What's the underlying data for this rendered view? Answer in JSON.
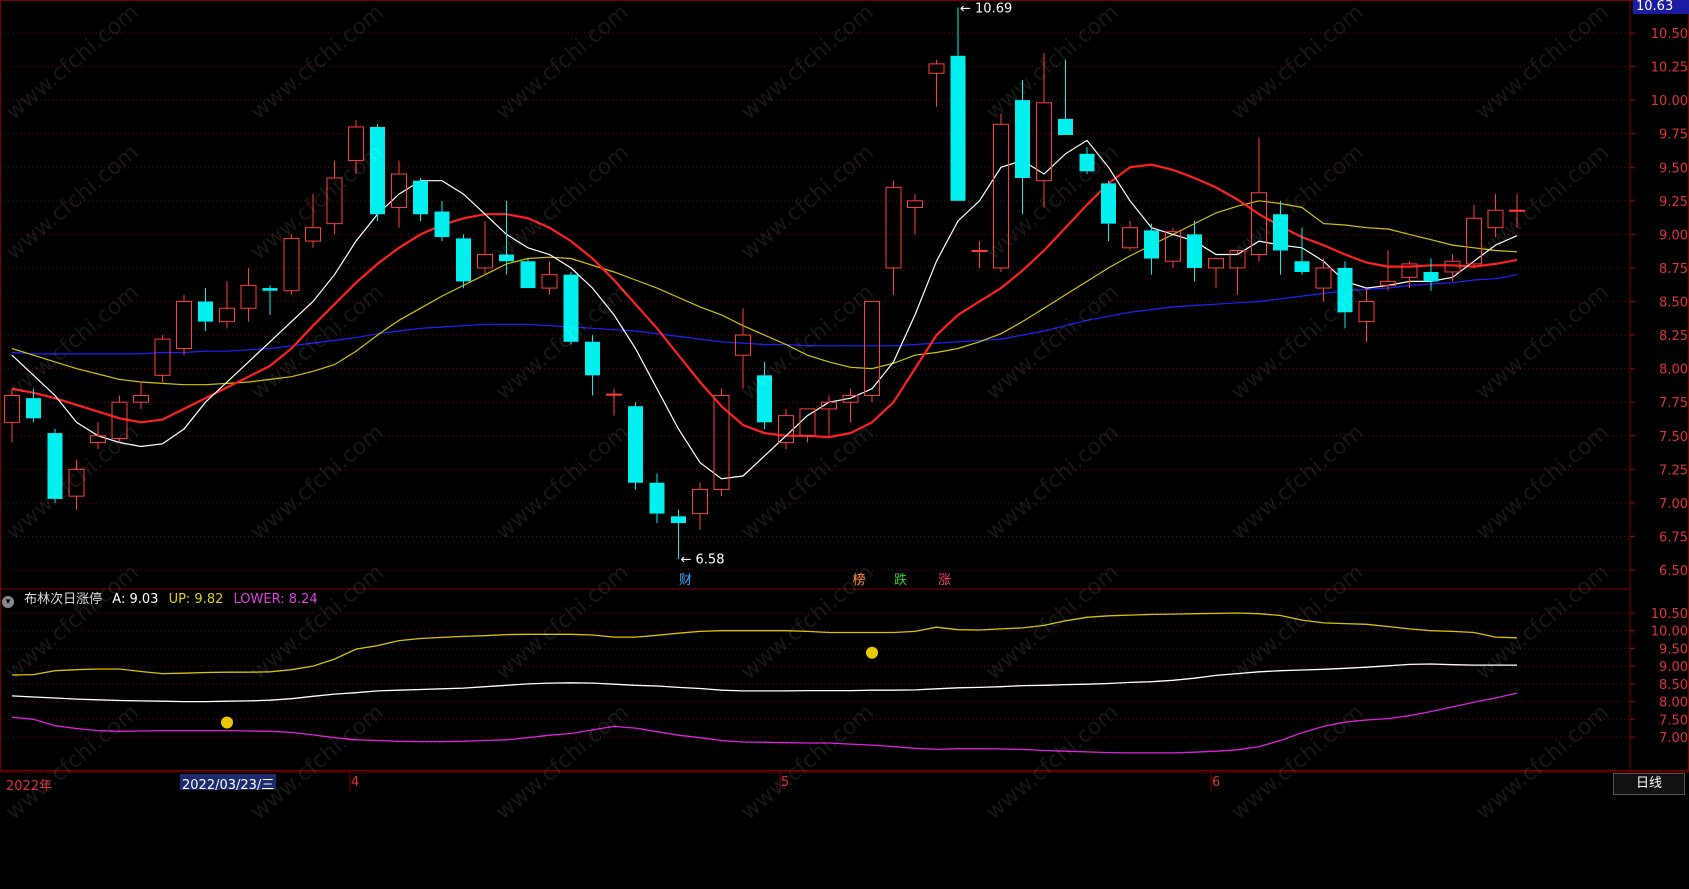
{
  "price_tag": "10.63",
  "period_label": "日线",
  "indicator": {
    "name": "布林次日涨停",
    "a_label": "A: 9.03",
    "up_label": "UP: 9.82",
    "lower_label": "LOWER: 8.24"
  },
  "x_axis": {
    "year_label": "2022年",
    "cursor_date": "2022/03/23/三",
    "months": [
      "4",
      "5",
      "6"
    ]
  },
  "markers": {
    "high_label": "10.69",
    "low_label": "6.58",
    "events": [
      "财",
      "榜",
      "跌",
      "涨"
    ]
  },
  "watermark": "www.cfchi.com",
  "colors": {
    "up": "#ff3b3b",
    "down": "#00f0f0",
    "ma5": "#ffffff",
    "ma10": "#ff2020",
    "ma20": "#d6c400",
    "ma60": "#2020ff",
    "grid": "#7a0000",
    "boll_up": "#d6c400",
    "boll_mid": "#ffffff",
    "boll_low": "#e020e0"
  },
  "chart_data": [
    {
      "type": "candlestick",
      "ylim": [
        6.45,
        10.69
      ],
      "yticks": [
        "10.50",
        "10.25",
        "10.00",
        "9.75",
        "9.50",
        "9.25",
        "9.00",
        "8.75",
        "8.50",
        "8.25",
        "8.00",
        "7.75",
        "7.50",
        "7.25",
        "7.00",
        "6.75",
        "6.50"
      ],
      "candles": [
        {
          "o": 7.6,
          "h": 7.85,
          "l": 7.45,
          "c": 7.8
        },
        {
          "o": 7.78,
          "h": 7.85,
          "l": 7.6,
          "c": 7.63
        },
        {
          "o": 7.52,
          "h": 7.55,
          "l": 7.0,
          "c": 7.03
        },
        {
          "o": 7.05,
          "h": 7.32,
          "l": 6.95,
          "c": 7.25
        },
        {
          "o": 7.45,
          "h": 7.6,
          "l": 7.4,
          "c": 7.5
        },
        {
          "o": 7.48,
          "h": 7.8,
          "l": 7.45,
          "c": 7.75
        },
        {
          "o": 7.75,
          "h": 7.9,
          "l": 7.7,
          "c": 7.8
        },
        {
          "o": 7.95,
          "h": 8.25,
          "l": 7.9,
          "c": 8.22
        },
        {
          "o": 8.15,
          "h": 8.55,
          "l": 8.1,
          "c": 8.5
        },
        {
          "o": 8.5,
          "h": 8.6,
          "l": 8.28,
          "c": 8.35
        },
        {
          "o": 8.35,
          "h": 8.65,
          "l": 8.3,
          "c": 8.45
        },
        {
          "o": 8.45,
          "h": 8.75,
          "l": 8.35,
          "c": 8.62
        },
        {
          "o": 8.6,
          "h": 8.62,
          "l": 8.4,
          "c": 8.58
        },
        {
          "o": 8.58,
          "h": 9.0,
          "l": 8.55,
          "c": 8.97
        },
        {
          "o": 8.95,
          "h": 9.3,
          "l": 8.9,
          "c": 9.05
        },
        {
          "o": 9.08,
          "h": 9.55,
          "l": 9.0,
          "c": 9.42
        },
        {
          "o": 9.55,
          "h": 9.85,
          "l": 9.45,
          "c": 9.8
        },
        {
          "o": 9.8,
          "h": 9.82,
          "l": 9.1,
          "c": 9.15
        },
        {
          "o": 9.2,
          "h": 9.55,
          "l": 9.05,
          "c": 9.45
        },
        {
          "o": 9.4,
          "h": 9.42,
          "l": 9.1,
          "c": 9.15
        },
        {
          "o": 9.17,
          "h": 9.25,
          "l": 8.95,
          "c": 8.98
        },
        {
          "o": 8.97,
          "h": 9.0,
          "l": 8.6,
          "c": 8.65
        },
        {
          "o": 8.75,
          "h": 9.1,
          "l": 8.7,
          "c": 8.85
        },
        {
          "o": 8.85,
          "h": 9.25,
          "l": 8.7,
          "c": 8.8
        },
        {
          "o": 8.8,
          "h": 8.82,
          "l": 8.6,
          "c": 8.6
        },
        {
          "o": 8.6,
          "h": 8.8,
          "l": 8.55,
          "c": 8.7
        },
        {
          "o": 8.7,
          "h": 8.72,
          "l": 8.18,
          "c": 8.2
        },
        {
          "o": 8.2,
          "h": 8.25,
          "l": 7.8,
          "c": 7.95
        },
        {
          "o": 7.81,
          "h": 7.85,
          "l": 7.65,
          "c": 7.81
        },
        {
          "o": 7.72,
          "h": 7.75,
          "l": 7.1,
          "c": 7.15
        },
        {
          "o": 7.15,
          "h": 7.22,
          "l": 6.85,
          "c": 6.92
        },
        {
          "o": 6.9,
          "h": 6.95,
          "l": 6.58,
          "c": 6.85
        },
        {
          "o": 6.92,
          "h": 7.15,
          "l": 6.8,
          "c": 7.1
        },
        {
          "o": 7.1,
          "h": 7.85,
          "l": 7.05,
          "c": 7.8
        },
        {
          "o": 8.1,
          "h": 8.45,
          "l": 7.85,
          "c": 8.25
        },
        {
          "o": 7.95,
          "h": 8.05,
          "l": 7.55,
          "c": 7.6
        },
        {
          "o": 7.45,
          "h": 7.7,
          "l": 7.4,
          "c": 7.65
        },
        {
          "o": 7.5,
          "h": 7.7,
          "l": 7.45,
          "c": 7.7
        },
        {
          "o": 7.7,
          "h": 7.8,
          "l": 7.5,
          "c": 7.75
        },
        {
          "o": 7.75,
          "h": 7.85,
          "l": 7.6,
          "c": 7.8
        },
        {
          "o": 7.8,
          "h": 8.5,
          "l": 7.75,
          "c": 8.5
        },
        {
          "o": 8.75,
          "h": 9.4,
          "l": 8.55,
          "c": 9.35
        },
        {
          "o": 9.2,
          "h": 9.3,
          "l": 9.0,
          "c": 9.25
        },
        {
          "o": 10.2,
          "h": 10.3,
          "l": 9.95,
          "c": 10.27
        },
        {
          "o": 10.33,
          "h": 10.69,
          "l": 9.25,
          "c": 9.25
        },
        {
          "o": 8.88,
          "h": 8.95,
          "l": 8.75,
          "c": 8.88
        },
        {
          "o": 8.75,
          "h": 9.9,
          "l": 8.72,
          "c": 9.82
        },
        {
          "o": 10.0,
          "h": 10.15,
          "l": 9.15,
          "c": 9.42
        },
        {
          "o": 9.4,
          "h": 10.35,
          "l": 9.2,
          "c": 9.98
        },
        {
          "o": 9.86,
          "h": 10.3,
          "l": 9.74,
          "c": 9.74
        },
        {
          "o": 9.6,
          "h": 9.65,
          "l": 9.45,
          "c": 9.47
        },
        {
          "o": 9.38,
          "h": 9.4,
          "l": 8.95,
          "c": 9.08
        },
        {
          "o": 8.9,
          "h": 9.1,
          "l": 8.88,
          "c": 9.05
        },
        {
          "o": 9.03,
          "h": 9.08,
          "l": 8.7,
          "c": 8.82
        },
        {
          "o": 8.8,
          "h": 9.05,
          "l": 8.75,
          "c": 9.02
        },
        {
          "o": 9.0,
          "h": 9.1,
          "l": 8.65,
          "c": 8.75
        },
        {
          "o": 8.75,
          "h": 8.82,
          "l": 8.6,
          "c": 8.82
        },
        {
          "o": 8.75,
          "h": 8.85,
          "l": 8.55,
          "c": 8.88
        },
        {
          "o": 8.85,
          "h": 9.72,
          "l": 8.8,
          "c": 9.31
        },
        {
          "o": 9.15,
          "h": 9.25,
          "l": 8.7,
          "c": 8.88
        },
        {
          "o": 8.8,
          "h": 9.05,
          "l": 8.7,
          "c": 8.72
        },
        {
          "o": 8.6,
          "h": 8.82,
          "l": 8.5,
          "c": 8.75
        },
        {
          "o": 8.75,
          "h": 8.8,
          "l": 8.3,
          "c": 8.42
        },
        {
          "o": 8.35,
          "h": 8.6,
          "l": 8.2,
          "c": 8.5
        },
        {
          "o": 8.62,
          "h": 8.88,
          "l": 8.58,
          "c": 8.65
        },
        {
          "o": 8.68,
          "h": 8.8,
          "l": 8.6,
          "c": 8.78
        },
        {
          "o": 8.72,
          "h": 8.82,
          "l": 8.58,
          "c": 8.65
        },
        {
          "o": 8.72,
          "h": 8.85,
          "l": 8.65,
          "c": 8.8
        },
        {
          "o": 8.78,
          "h": 9.22,
          "l": 8.75,
          "c": 9.12
        },
        {
          "o": 9.05,
          "h": 9.3,
          "l": 8.98,
          "c": 9.18
        },
        {
          "o": 9.18,
          "h": 9.3,
          "l": 9.05,
          "c": 9.18
        }
      ],
      "ma5": [
        8.1,
        7.95,
        7.8,
        7.6,
        7.5,
        7.45,
        7.42,
        7.44,
        7.55,
        7.75,
        7.9,
        8.05,
        8.2,
        8.35,
        8.5,
        8.7,
        8.95,
        9.15,
        9.3,
        9.4,
        9.4,
        9.3,
        9.15,
        9.0,
        8.9,
        8.85,
        8.75,
        8.6,
        8.4,
        8.15,
        7.85,
        7.55,
        7.3,
        7.18,
        7.2,
        7.35,
        7.5,
        7.65,
        7.75,
        7.78,
        7.85,
        8.05,
        8.4,
        8.8,
        9.1,
        9.25,
        9.5,
        9.55,
        9.45,
        9.6,
        9.7,
        9.5,
        9.25,
        9.05,
        9.0,
        8.95,
        8.85,
        8.85,
        8.95,
        8.92,
        8.9,
        8.8,
        8.65,
        8.6,
        8.62,
        8.65,
        8.65,
        8.68,
        8.8,
        8.92,
        8.99
      ],
      "ma10": [
        7.85,
        7.82,
        7.78,
        7.73,
        7.68,
        7.63,
        7.6,
        7.62,
        7.7,
        7.78,
        7.86,
        7.94,
        8.02,
        8.15,
        8.32,
        8.48,
        8.64,
        8.78,
        8.9,
        9.0,
        9.07,
        9.12,
        9.15,
        9.15,
        9.12,
        9.05,
        8.95,
        8.82,
        8.66,
        8.48,
        8.3,
        8.1,
        7.9,
        7.72,
        7.58,
        7.52,
        7.5,
        7.5,
        7.49,
        7.52,
        7.6,
        7.75,
        8.0,
        8.25,
        8.4,
        8.5,
        8.6,
        8.73,
        8.88,
        9.05,
        9.22,
        9.38,
        9.5,
        9.52,
        9.48,
        9.42,
        9.35,
        9.26,
        9.15,
        9.06,
        8.98,
        8.92,
        8.85,
        8.79,
        8.76,
        8.76,
        8.77,
        8.77,
        8.76,
        8.78,
        8.81
      ],
      "ma20": [
        8.15,
        8.1,
        8.05,
        8.0,
        7.96,
        7.92,
        7.9,
        7.89,
        7.88,
        7.88,
        7.89,
        7.9,
        7.92,
        7.94,
        7.98,
        8.03,
        8.13,
        8.25,
        8.36,
        8.45,
        8.54,
        8.62,
        8.7,
        8.78,
        8.82,
        8.83,
        8.82,
        8.77,
        8.72,
        8.66,
        8.6,
        8.53,
        8.46,
        8.4,
        8.32,
        8.25,
        8.18,
        8.1,
        8.05,
        8.01,
        8.0,
        8.04,
        8.1,
        8.12,
        8.15,
        8.2,
        8.26,
        8.35,
        8.45,
        8.55,
        8.65,
        8.75,
        8.84,
        8.92,
        9.0,
        9.08,
        9.16,
        9.21,
        9.25,
        9.23,
        9.2,
        9.08,
        9.07,
        9.05,
        9.04,
        9.0,
        8.96,
        8.92,
        8.9,
        8.88,
        8.87
      ],
      "ma60": [
        8.12,
        8.11,
        8.11,
        8.11,
        8.11,
        8.11,
        8.11,
        8.12,
        8.12,
        8.13,
        8.13,
        8.14,
        8.15,
        8.17,
        8.19,
        8.21,
        8.23,
        8.26,
        8.28,
        8.3,
        8.31,
        8.32,
        8.33,
        8.33,
        8.33,
        8.32,
        8.31,
        8.3,
        8.29,
        8.28,
        8.26,
        8.24,
        8.22,
        8.2,
        8.19,
        8.18,
        8.18,
        8.17,
        8.17,
        8.17,
        8.17,
        8.17,
        8.18,
        8.19,
        8.2,
        8.21,
        8.22,
        8.25,
        8.28,
        8.32,
        8.36,
        8.39,
        8.42,
        8.44,
        8.46,
        8.47,
        8.48,
        8.49,
        8.5,
        8.52,
        8.54,
        8.56,
        8.58,
        8.59,
        8.6,
        8.62,
        8.63,
        8.64,
        8.66,
        8.67,
        8.7
      ]
    },
    {
      "type": "line",
      "title": "布林次日涨停",
      "ylim": [
        6.65,
        10.75
      ],
      "yticks": [
        "10.50",
        "10.00",
        "9.50",
        "9.00",
        "8.50",
        "8.00",
        "7.50",
        "7.00"
      ],
      "series": [
        {
          "name": "UP",
          "values": [
            8.75,
            8.76,
            8.87,
            8.9,
            8.92,
            8.92,
            8.85,
            8.79,
            8.8,
            8.82,
            8.83,
            8.83,
            8.84,
            8.9,
            9.0,
            9.2,
            9.48,
            9.58,
            9.72,
            9.78,
            9.81,
            9.84,
            9.86,
            9.89,
            9.9,
            9.9,
            9.9,
            9.88,
            9.82,
            9.82,
            9.87,
            9.93,
            9.98,
            10.0,
            10.0,
            10.0,
            10.0,
            9.98,
            9.95,
            9.95,
            9.95,
            9.95,
            9.98,
            10.1,
            10.03,
            10.02,
            10.05,
            10.08,
            10.15,
            10.28,
            10.38,
            10.42,
            10.44,
            10.46,
            10.47,
            10.48,
            10.49,
            10.5,
            10.48,
            10.43,
            10.3,
            10.22,
            10.2,
            10.18,
            10.12,
            10.05,
            10.0,
            9.98,
            9.95,
            9.82,
            9.8
          ]
        },
        {
          "name": "A",
          "values": [
            8.16,
            8.13,
            8.1,
            8.07,
            8.05,
            8.03,
            8.02,
            8.01,
            8.0,
            8.0,
            8.01,
            8.02,
            8.04,
            8.08,
            8.15,
            8.21,
            8.25,
            8.3,
            8.32,
            8.34,
            8.36,
            8.38,
            8.42,
            8.46,
            8.5,
            8.52,
            8.53,
            8.52,
            8.49,
            8.46,
            8.44,
            8.4,
            8.37,
            8.32,
            8.3,
            8.3,
            8.3,
            8.31,
            8.31,
            8.31,
            8.32,
            8.32,
            8.33,
            8.36,
            8.39,
            8.4,
            8.42,
            8.45,
            8.46,
            8.48,
            8.49,
            8.51,
            8.54,
            8.56,
            8.6,
            8.66,
            8.74,
            8.79,
            8.84,
            8.87,
            8.89,
            8.91,
            8.94,
            8.97,
            9.01,
            9.05,
            9.06,
            9.04,
            9.03,
            9.03,
            9.03
          ]
        },
        {
          "name": "LOWER",
          "values": [
            7.56,
            7.5,
            7.32,
            7.24,
            7.18,
            7.16,
            7.17,
            7.18,
            7.18,
            7.18,
            7.18,
            7.17,
            7.16,
            7.13,
            7.06,
            6.98,
            6.92,
            6.9,
            6.88,
            6.87,
            6.87,
            6.88,
            6.9,
            6.92,
            6.98,
            7.05,
            7.1,
            7.2,
            7.3,
            7.25,
            7.15,
            7.05,
            6.98,
            6.9,
            6.86,
            6.85,
            6.84,
            6.83,
            6.83,
            6.8,
            6.77,
            6.73,
            6.68,
            6.65,
            6.67,
            6.67,
            6.66,
            6.65,
            6.62,
            6.6,
            6.58,
            6.56,
            6.55,
            6.55,
            6.55,
            6.57,
            6.6,
            6.64,
            6.73,
            6.9,
            7.12,
            7.3,
            7.42,
            7.48,
            7.52,
            7.6,
            7.72,
            7.85,
            7.98,
            8.1,
            8.24
          ]
        }
      ]
    }
  ]
}
